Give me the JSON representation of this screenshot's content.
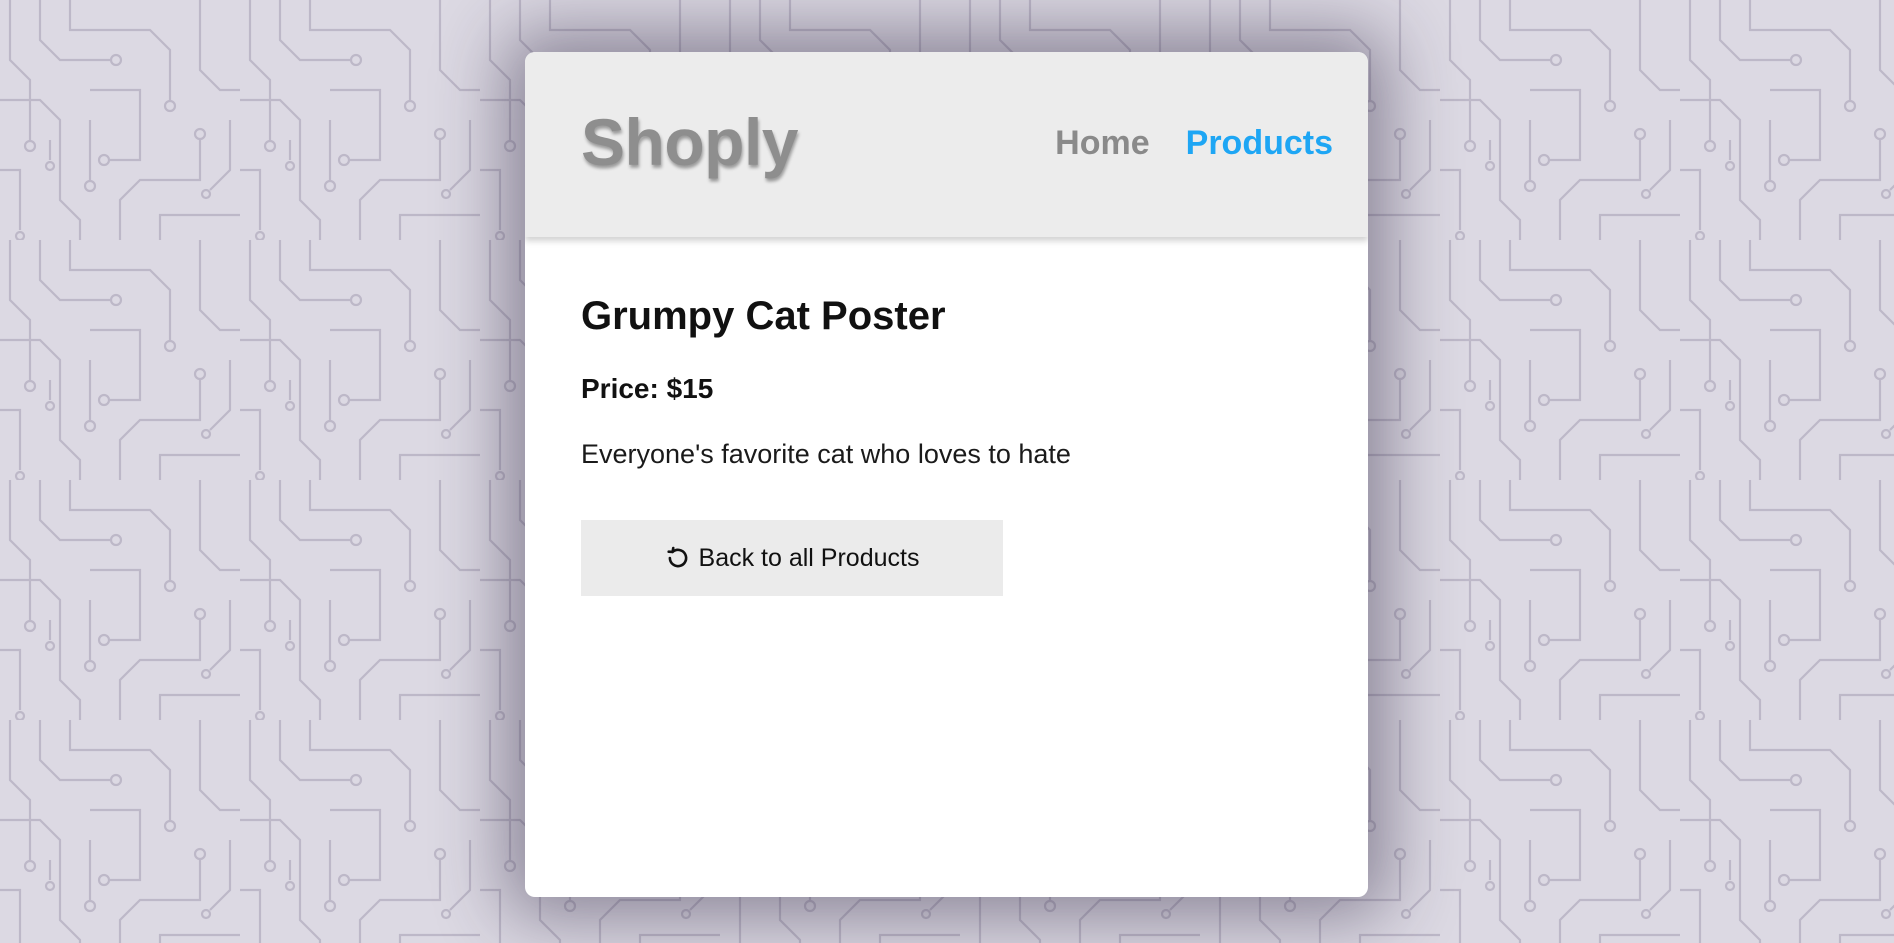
{
  "header": {
    "logo": "Shoply",
    "nav": {
      "home": "Home",
      "products": "Products"
    }
  },
  "product": {
    "title": "Grumpy Cat Poster",
    "price": "Price: $15",
    "description": "Everyone's favorite cat who loves to hate"
  },
  "actions": {
    "back_label": "Back to all Products",
    "back_icon": "undo-icon"
  },
  "colors": {
    "background": "#dcd9e3",
    "header_bg": "#ececec",
    "logo": "#8e8e8e",
    "nav_active": "#1ea6f4",
    "nav_inactive": "#8a8a8a",
    "button_bg": "#ebebeb"
  }
}
